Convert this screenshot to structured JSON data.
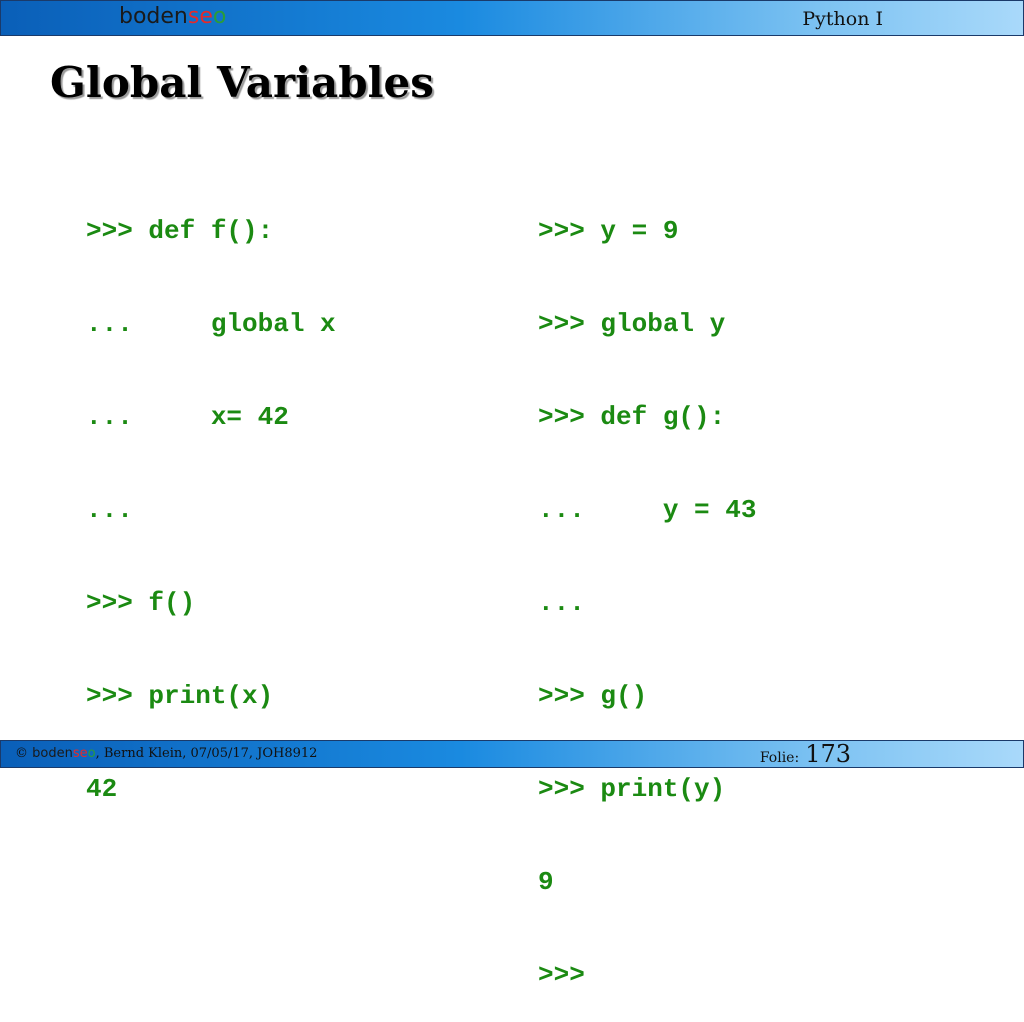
{
  "header": {
    "logo": {
      "part1": "boden",
      "part2": "se",
      "part3": "o"
    },
    "course_title": "Python I"
  },
  "slide": {
    "title": "Global Variables"
  },
  "code": {
    "left": [
      ">>> def f():",
      "...     global x",
      "...     x= 42",
      "...",
      ">>> f()",
      ">>> print(x)",
      "42"
    ],
    "right": [
      ">>> y = 9",
      ">>> global y",
      ">>> def g():",
      "...     y = 43",
      "...",
      ">>> g()",
      ">>> print(y)",
      "9",
      ">>>"
    ]
  },
  "footer": {
    "copyright_symbol": "©",
    "logo": {
      "part1": "boden",
      "part2": "se",
      "part3": "o"
    },
    "credit": ", Bernd Klein, 07/05/17, JOH8912",
    "folie_label": "Folie:",
    "folie_number": "173"
  },
  "colors": {
    "code_green": "#1b8a12",
    "header_blue": "#1a8ae0",
    "logo_red": "#e52a2a",
    "logo_green": "#2a9c3a"
  }
}
